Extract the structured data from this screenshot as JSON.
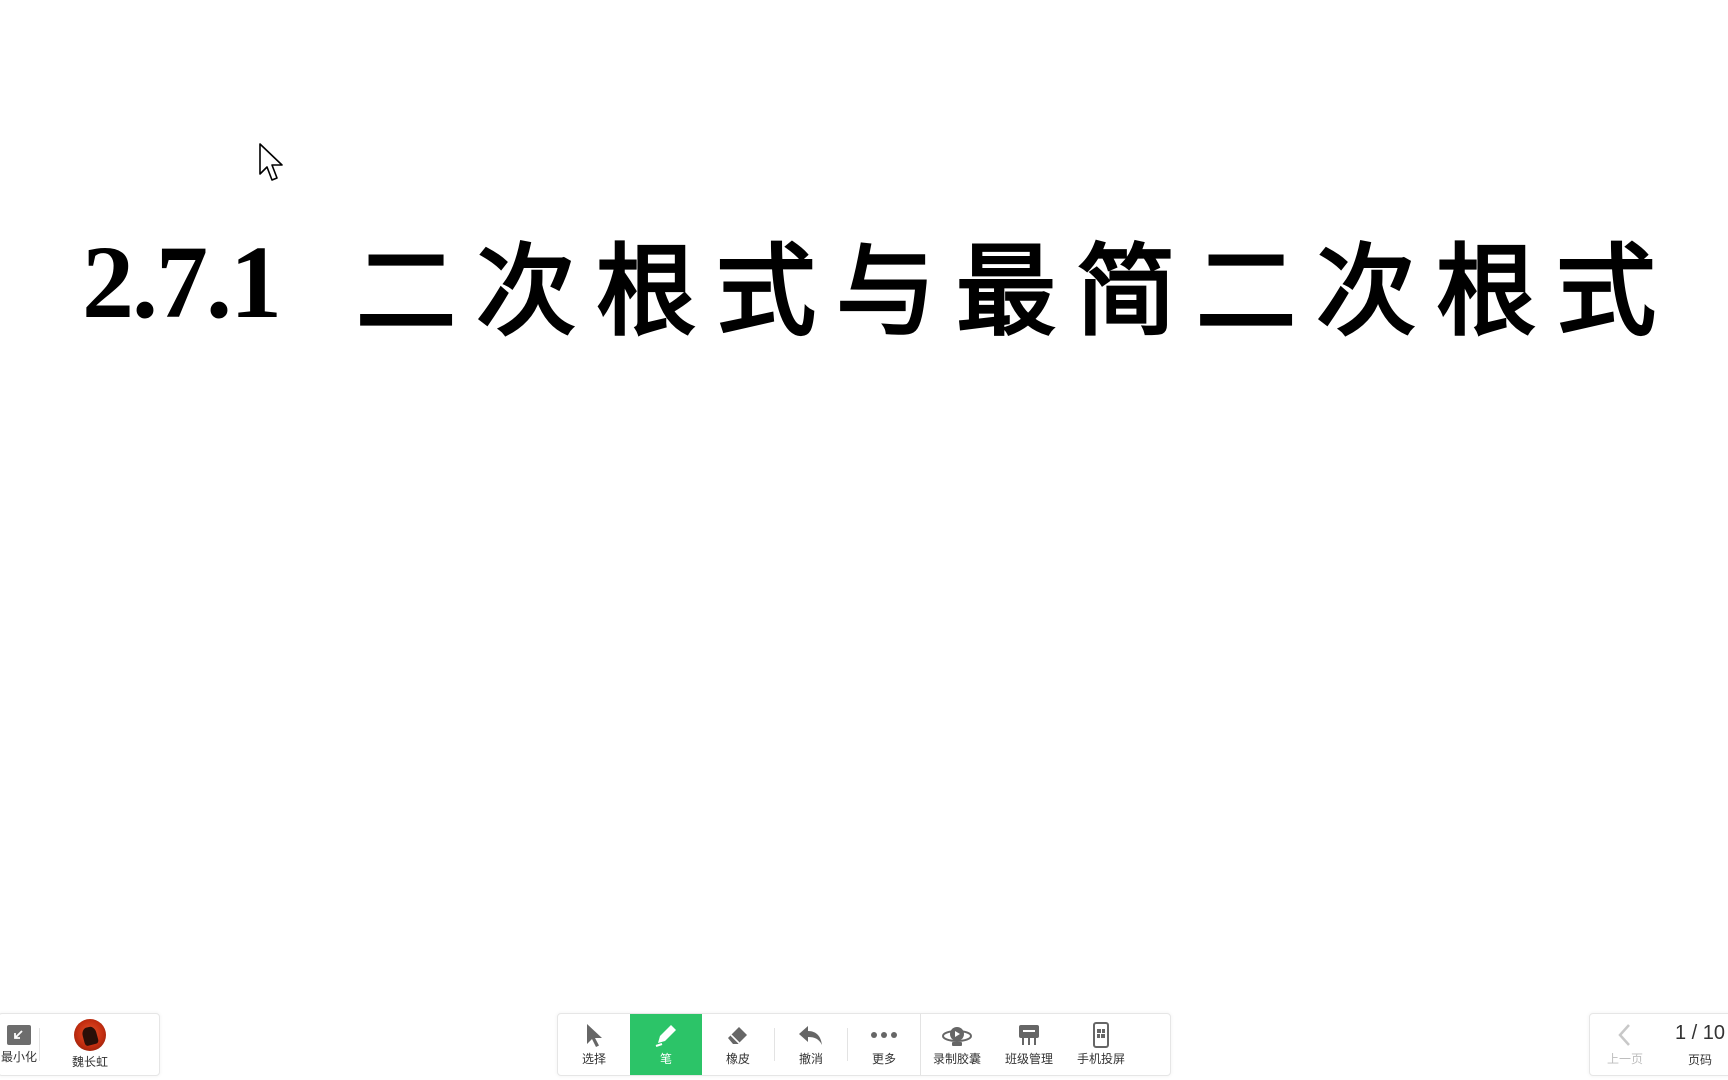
{
  "slide": {
    "title_number": "2.7.1",
    "title_text": "二次根式与最简二次根式"
  },
  "left_toolbar": {
    "minimize_label": "最小化",
    "user_name": "魏长虹"
  },
  "main_toolbar": {
    "select_label": "选择",
    "pen_label": "笔",
    "eraser_label": "橡皮",
    "undo_label": "撤消",
    "more_label": "更多",
    "record_label": "录制胶囊",
    "class_label": "班级管理",
    "phone_label": "手机投屏"
  },
  "pager": {
    "prev_label": "上一页",
    "page_count": "1 / 10",
    "page_label": "页码"
  },
  "colors": {
    "active_tool": "#2cc468",
    "icon": "#555555"
  }
}
